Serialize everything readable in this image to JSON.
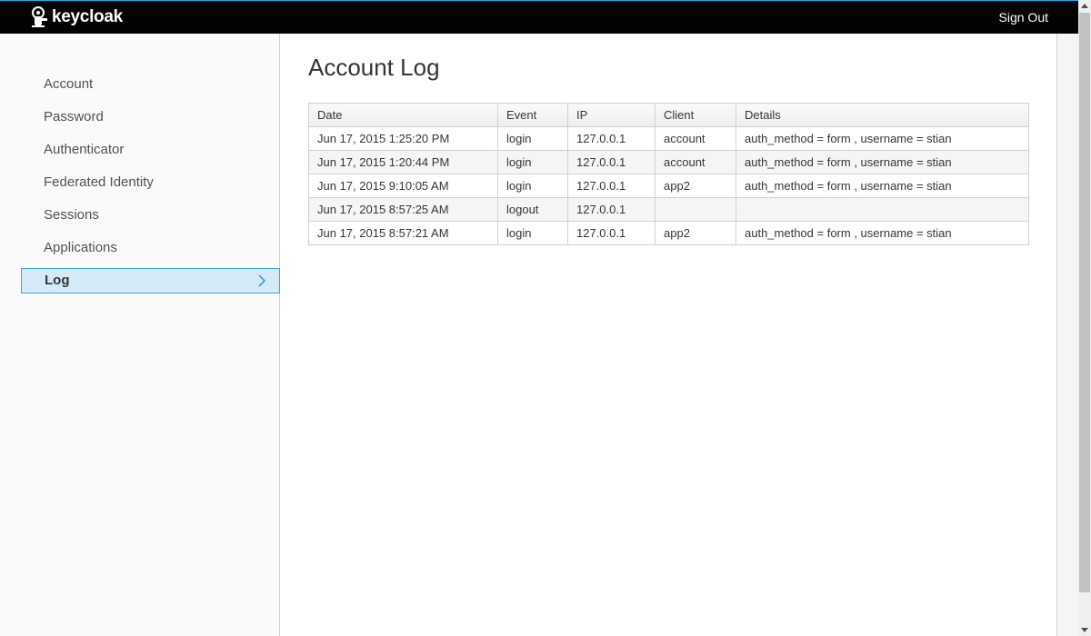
{
  "header": {
    "brand": "keycloak",
    "signout_label": "Sign Out",
    "logo_icon": "keycloak-logo-icon"
  },
  "sidebar": {
    "items": [
      {
        "label": "Account",
        "active": false
      },
      {
        "label": "Password",
        "active": false
      },
      {
        "label": "Authenticator",
        "active": false
      },
      {
        "label": "Federated Identity",
        "active": false
      },
      {
        "label": "Sessions",
        "active": false
      },
      {
        "label": "Applications",
        "active": false
      },
      {
        "label": "Log",
        "active": true
      }
    ],
    "active_icon": "chevron-right-icon"
  },
  "main": {
    "title": "Account Log",
    "table": {
      "columns": [
        "Date",
        "Event",
        "IP",
        "Client",
        "Details"
      ],
      "rows": [
        [
          "Jun 17, 2015 1:25:20 PM",
          "login",
          "127.0.0.1",
          "account",
          "auth_method = form , username = stian"
        ],
        [
          "Jun 17, 2015 1:20:44 PM",
          "login",
          "127.0.0.1",
          "account",
          "auth_method = form , username = stian"
        ],
        [
          "Jun 17, 2015 9:10:05 AM",
          "login",
          "127.0.0.1",
          "app2",
          "auth_method = form , username = stian"
        ],
        [
          "Jun 17, 2015 8:57:25 AM",
          "logout",
          "127.0.0.1",
          "",
          ""
        ],
        [
          "Jun 17, 2015 8:57:21 AM",
          "login",
          "127.0.0.1",
          "app2",
          "auth_method = form , username = stian"
        ]
      ]
    }
  },
  "colors": {
    "topbar_bg": "#030303",
    "accent": "#39a5dc",
    "active_bg": "#d4eaf6",
    "sidebar_bg": "#fafafa"
  }
}
